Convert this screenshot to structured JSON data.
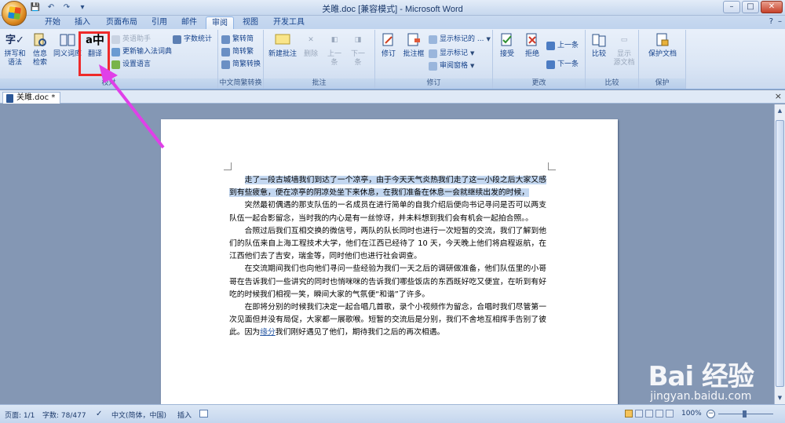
{
  "window": {
    "title": "关雎.doc [兼容模式] - Microsoft Word",
    "controls": {
      "minimize": "–",
      "maximize": "□",
      "close": "✕"
    }
  },
  "quick_access": [
    {
      "name": "save-icon",
      "glyph": "💾"
    },
    {
      "name": "undo-icon",
      "glyph": "↶"
    },
    {
      "name": "redo-icon",
      "glyph": "↷"
    },
    {
      "name": "customize-qat-icon",
      "glyph": "▾"
    }
  ],
  "tabs": [
    {
      "label": "开始",
      "active": false
    },
    {
      "label": "插入",
      "active": false
    },
    {
      "label": "页面布局",
      "active": false
    },
    {
      "label": "引用",
      "active": false
    },
    {
      "label": "邮件",
      "active": false
    },
    {
      "label": "审阅",
      "active": true
    },
    {
      "label": "视图",
      "active": false
    },
    {
      "label": "开发工具",
      "active": false
    }
  ],
  "tabbar_right": {
    "help": "?",
    "ribbon_toggle": "–"
  },
  "ribbon": {
    "proofing": {
      "label": "校对",
      "spelling": "拼写和\n语法",
      "research": "信息\n检索",
      "thesaurus": "同义词库",
      "translate": "翻译",
      "translation_tip": "英语助手",
      "update_ime": "更新输入法词典",
      "set_language": "设置语言",
      "word_count": "字数统计"
    },
    "chinese": {
      "label": "中文简繁转换",
      "to_traditional": "繁转简",
      "to_simplified": "简转繁",
      "convert": "简繁转换"
    },
    "comments": {
      "label": "批注",
      "new": "新建批注",
      "delete": "删除",
      "prev": "上一\n条",
      "next": "下一\n条"
    },
    "tracking": {
      "label": "修订",
      "track": "修订",
      "balloons": "批注框",
      "display": "显示标记的 ...",
      "show_markup": "显示标记",
      "reviewing_pane": "审阅窗格"
    },
    "changes": {
      "label": "更改",
      "accept": "接受",
      "reject": "拒绝",
      "previous": "上一条",
      "next": "下一条"
    },
    "compare": {
      "label": "比较",
      "compare": "比较",
      "show_source": "显示\n源文档"
    },
    "protect": {
      "label": "保护",
      "protect_doc": "保护文档"
    }
  },
  "document_tab": {
    "name": "关雎.doc *",
    "close": "×"
  },
  "document": {
    "paragraphs": [
      {
        "text": "走了一段古城墙我们到达了一个凉亭，由于今天天气炎热我们走了这一小段之后大家又感到有些疲惫，便在凉亭的阴凉处坐下来休息，在我们准备在休息一会就继续出发的时候，",
        "selected": true
      },
      {
        "text": "突然最初偶遇的那支队伍的一名成员在进行简单的自我介绍后便向书记寻问是否可以两支队伍一起合影留念，当时我的内心是有一丝惊讶，并未料想到我们会有机会一起拍合照。。"
      },
      {
        "text": "合照过后我们互相交换的微信号，两队的队长同时也进行一次短暂的交流，我们了解到他们的队伍来自上海工程技术大学，他们在江西已经待了 10 天，今天晚上他们将启程返航，在江西他们去了吉安，瑞金等，同时他们也进行社会调查。"
      },
      {
        "text": "在交流期间我们也向他们寻问一些经验为我们一天之后的调研做准备，他们队伍里的小哥哥在告诉我们一些讲究的同时也悄咪咪的告诉我们哪些饭店的东西既好吃又便宜，在听到有好吃的时候我们相视一笑，瞬间大家的气氛便“和谐”了许多。"
      },
      {
        "text_before": "在即将分别的时候我们决定一起合唱几首歌，录个小视频作为留念，合唱时我们尽管第一次见面但并没有局促，大家都一展歌喉。短暂的交流后是分别，我们不舍地互相挥手告别了彼此。因为",
        "underlined": "缘分",
        "text_after": "我们刚好遇见了他们，期待我们之后的再次相遇。"
      }
    ]
  },
  "status": {
    "page": "页面: 1/1",
    "words": "字数: 78/477",
    "language": "中文(简体，中国)",
    "mode": "插入",
    "zoom": "100%"
  },
  "watermark": {
    "logo": "Bai 经验",
    "url": "jingyan.baidu.com"
  }
}
